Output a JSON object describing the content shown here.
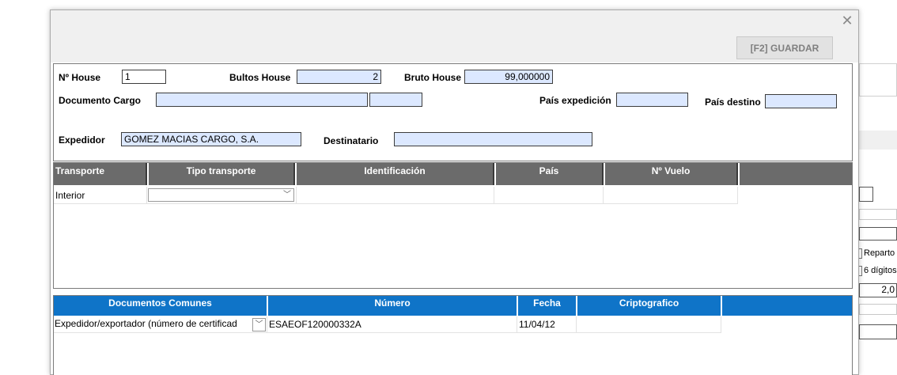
{
  "toolbar": {
    "save_label": "[F2] GUARDAR",
    "close_icon": "close-icon"
  },
  "form": {
    "house_label": "Nº House",
    "house_value": "1",
    "bultos_label": "Bultos House",
    "bultos_value": "2",
    "bruto_label": "Bruto House",
    "bruto_value": "99,000000",
    "documento_label": "Documento Cargo",
    "documento_value": "",
    "documento_value2": "",
    "pais_exp_label": "País expedición",
    "pais_exp_value": "",
    "pais_dest_label": "País destino",
    "pais_dest_value": "",
    "expedidor_label": "Expedidor",
    "expedidor_value": "GOMEZ MACIAS CARGO, S.A.",
    "destinatario_label": "Destinatario",
    "destinatario_value": ""
  },
  "transport_grid": {
    "columns": [
      "Transporte",
      "Tipo transporte",
      "Identificación",
      "País",
      "Nº Vuelo"
    ],
    "rows": [
      {
        "transporte": "Interior",
        "tipo": "",
        "identificacion": "",
        "pais": "",
        "vuelo": ""
      }
    ],
    "header_color": "#6b6b6b"
  },
  "docs_grid": {
    "columns": [
      "Documentos Comunes",
      "Número",
      "Fecha",
      "Criptografico"
    ],
    "rows": [
      {
        "documento": "Expedidor/exportador (número de certificad",
        "numero": "ESAEOF120000332A",
        "fecha": "11/04/12",
        "cripto": ""
      }
    ],
    "header_color": "#0f74c8"
  },
  "background_app": {
    "reparto_label": "Reparto",
    "digitos_label": "6 dígitos",
    "value_text": "2,0"
  },
  "icons": {
    "chevron_down": "chevron-down-icon"
  }
}
